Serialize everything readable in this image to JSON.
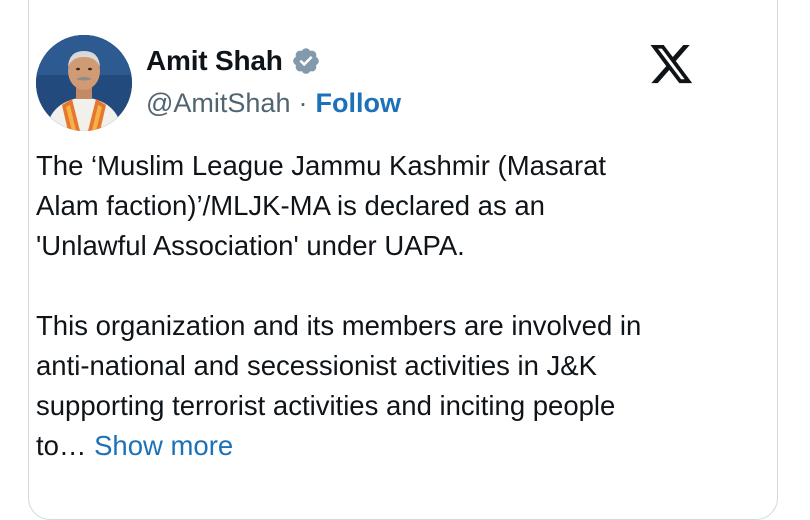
{
  "author": {
    "display_name": "Amit Shah",
    "handle": "@AmitShah",
    "separator": "·",
    "follow_label": "Follow",
    "verified_icon": "verified-badge-icon",
    "avatar": "avatar-photo"
  },
  "brand": {
    "logo_icon": "x-logo-icon"
  },
  "tweet": {
    "paragraph_1_lines": [
      "The ‘Muslim League Jammu Kashmir (Masarat",
      "Alam faction)’/MLJK-MA is declared as an",
      "'Unlawful Association' under UAPA."
    ],
    "paragraph_2_lines": [
      "This organization and its members are involved in",
      "anti-national and secessionist activities in J&K",
      "supporting terrorist activities and inciting people",
      "to…"
    ],
    "show_more_label": "Show more"
  },
  "colors": {
    "text_primary": "#0f1419",
    "text_secondary": "#536471",
    "link": "#1d71b8",
    "verified_badge": "#829aab",
    "border": "#cfd9de"
  }
}
